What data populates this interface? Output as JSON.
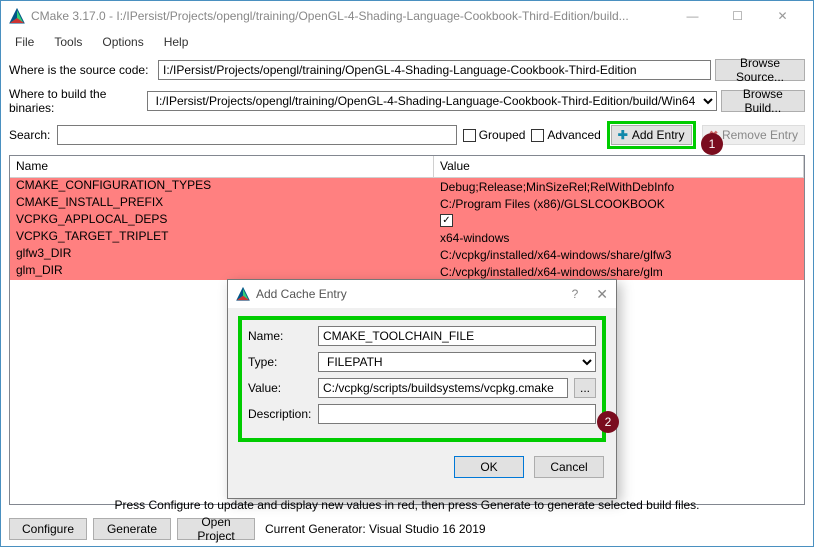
{
  "window": {
    "title": "CMake 3.17.0 - I:/IPersist/Projects/opengl/training/OpenGL-4-Shading-Language-Cookbook-Third-Edition/build..."
  },
  "menu": {
    "file": "File",
    "tools": "Tools",
    "options": "Options",
    "help": "Help"
  },
  "labels": {
    "source": "Where is the source code:",
    "build": "Where to build the binaries:",
    "search": "Search:",
    "grouped": "Grouped",
    "advanced": "Advanced",
    "add_entry": "Add Entry",
    "remove_entry": "Remove Entry",
    "browse_source": "Browse Source...",
    "browse_build": "Browse Build..."
  },
  "paths": {
    "source": "I:/IPersist/Projects/opengl/training/OpenGL-4-Shading-Language-Cookbook-Third-Edition",
    "build": "I:/IPersist/Projects/opengl/training/OpenGL-4-Shading-Language-Cookbook-Third-Edition/build/Win64"
  },
  "table": {
    "headers": {
      "name": "Name",
      "value": "Value"
    },
    "rows": [
      {
        "name": "CMAKE_CONFIGURATION_TYPES",
        "value": "Debug;Release;MinSizeRel;RelWithDebInfo",
        "type": "text"
      },
      {
        "name": "CMAKE_INSTALL_PREFIX",
        "value": "C:/Program Files (x86)/GLSLCOOKBOOK",
        "type": "text"
      },
      {
        "name": "VCPKG_APPLOCAL_DEPS",
        "value": "",
        "type": "check"
      },
      {
        "name": "VCPKG_TARGET_TRIPLET",
        "value": "x64-windows",
        "type": "text"
      },
      {
        "name": "glfw3_DIR",
        "value": "C:/vcpkg/installed/x64-windows/share/glfw3",
        "type": "text"
      },
      {
        "name": "glm_DIR",
        "value": "C:/vcpkg/installed/x64-windows/share/glm",
        "type": "text"
      }
    ]
  },
  "hint": "Press Configure to update and display new values in red, then press Generate to generate selected build files.",
  "bottom": {
    "configure": "Configure",
    "generate": "Generate",
    "open": "Open Project",
    "generator": "Current Generator: Visual Studio 16 2019"
  },
  "dialog": {
    "title": "Add Cache Entry",
    "labels": {
      "name": "Name:",
      "type": "Type:",
      "value": "Value:",
      "desc": "Description:"
    },
    "fields": {
      "name": "CMAKE_TOOLCHAIN_FILE",
      "type": "FILEPATH",
      "value": "C:/vcpkg/scripts/buildsystems/vcpkg.cmake",
      "desc": ""
    },
    "buttons": {
      "ok": "OK",
      "cancel": "Cancel"
    }
  },
  "badges": {
    "one": "1",
    "two": "2"
  }
}
